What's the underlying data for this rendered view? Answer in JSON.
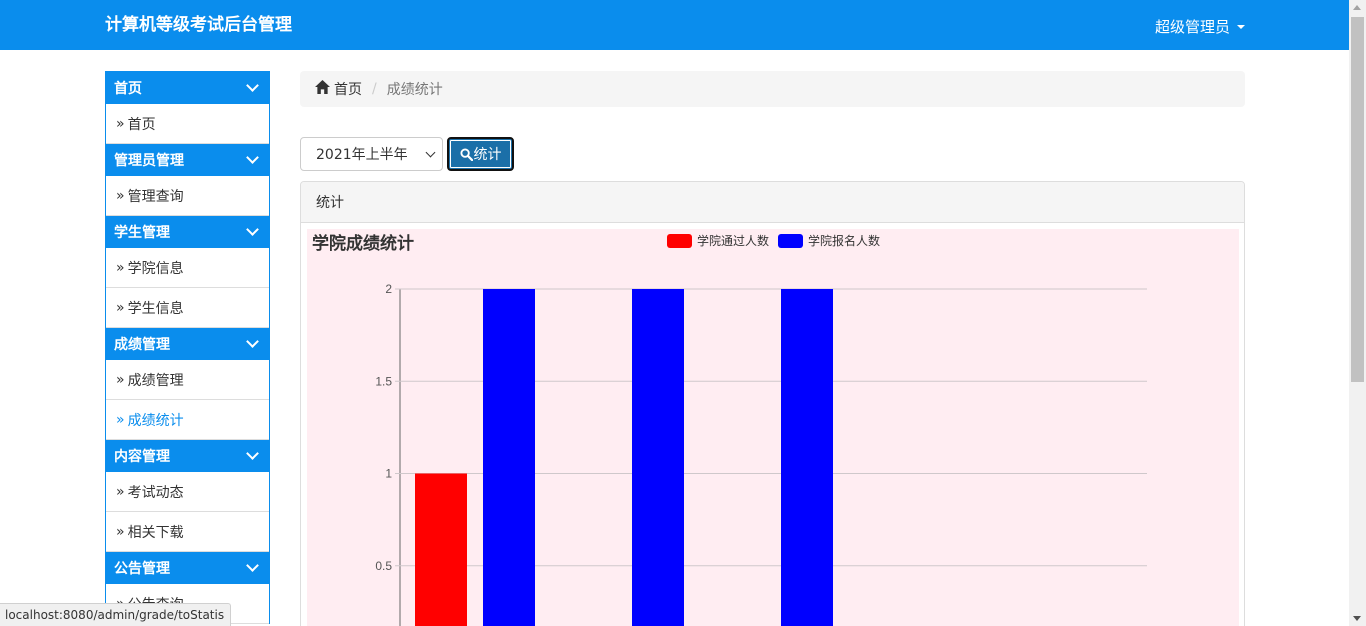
{
  "app": {
    "title": "计算机等级考试后台管理",
    "user_label": "超级管理员"
  },
  "sidebar": {
    "groups": [
      {
        "label": "首页",
        "items": [
          {
            "label": "首页"
          }
        ]
      },
      {
        "label": "管理员管理",
        "items": [
          {
            "label": "管理查询"
          }
        ]
      },
      {
        "label": "学生管理",
        "items": [
          {
            "label": "学院信息"
          },
          {
            "label": "学生信息"
          }
        ]
      },
      {
        "label": "成绩管理",
        "items": [
          {
            "label": "成绩管理"
          },
          {
            "label": "成绩统计",
            "active": true
          }
        ]
      },
      {
        "label": "内容管理",
        "items": [
          {
            "label": "考试动态"
          },
          {
            "label": "相关下载"
          }
        ]
      },
      {
        "label": "公告管理",
        "items": [
          {
            "label": "公告查询"
          }
        ]
      }
    ]
  },
  "breadcrumb": {
    "home": "首页",
    "current": "成绩统计"
  },
  "filter": {
    "semester_selected": "2021年上半年",
    "stat_button": "统计"
  },
  "panel": {
    "title": "统计"
  },
  "status_bar": {
    "url": "localhost:8080/admin/grade/toStatis"
  },
  "colors": {
    "primary": "#0a8ded",
    "button": "#1b6fa8",
    "chart_bg": "#ffedf2"
  },
  "chart_data": {
    "type": "bar",
    "title": "学院成绩统计",
    "legend_position": "top-center",
    "grid": true,
    "y_ticks": [
      "0.5",
      "1",
      "1.5",
      "2"
    ],
    "ylim": [
      0,
      2
    ],
    "categories": [
      "",
      "",
      ""
    ],
    "series": [
      {
        "name": "学院通过人数",
        "color": "#ff0000",
        "values": [
          1,
          0,
          0
        ]
      },
      {
        "name": "学院报名人数",
        "color": "#0000ff",
        "values": [
          2,
          2,
          2
        ]
      }
    ]
  }
}
